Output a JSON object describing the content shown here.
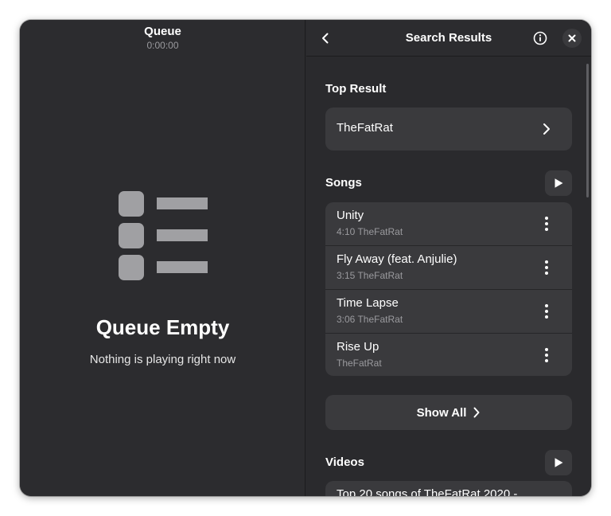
{
  "queue": {
    "title": "Queue",
    "time": "0:00:00",
    "empty_title": "Queue Empty",
    "empty_subtitle": "Nothing is playing right now",
    "illustration_icon": "queue-list-icon"
  },
  "search": {
    "title": "Search Results",
    "back_icon": "back-chevron-icon",
    "info_icon": "info-icon",
    "close_icon": "close-icon",
    "top_result": {
      "heading": "Top Result",
      "label": "TheFatRat"
    },
    "songs": {
      "heading": "Songs",
      "items": [
        {
          "title": "Unity",
          "meta": "4:10 TheFatRat"
        },
        {
          "title": "Fly Away (feat. Anjulie)",
          "meta": "3:15 TheFatRat"
        },
        {
          "title": "Time Lapse",
          "meta": "3:06 TheFatRat"
        },
        {
          "title": "Rise Up",
          "meta": "TheFatRat"
        }
      ],
      "show_all_label": "Show All"
    },
    "videos": {
      "heading": "Videos",
      "items": [
        {
          "title": "Top 20 songs of TheFatRat 2020 -"
        }
      ]
    }
  },
  "colors": {
    "window_bg": "#2a2a2d",
    "card_bg": "#3a3a3d",
    "muted_text": "#9a9a9e",
    "illustration": "#a0a0a3"
  }
}
